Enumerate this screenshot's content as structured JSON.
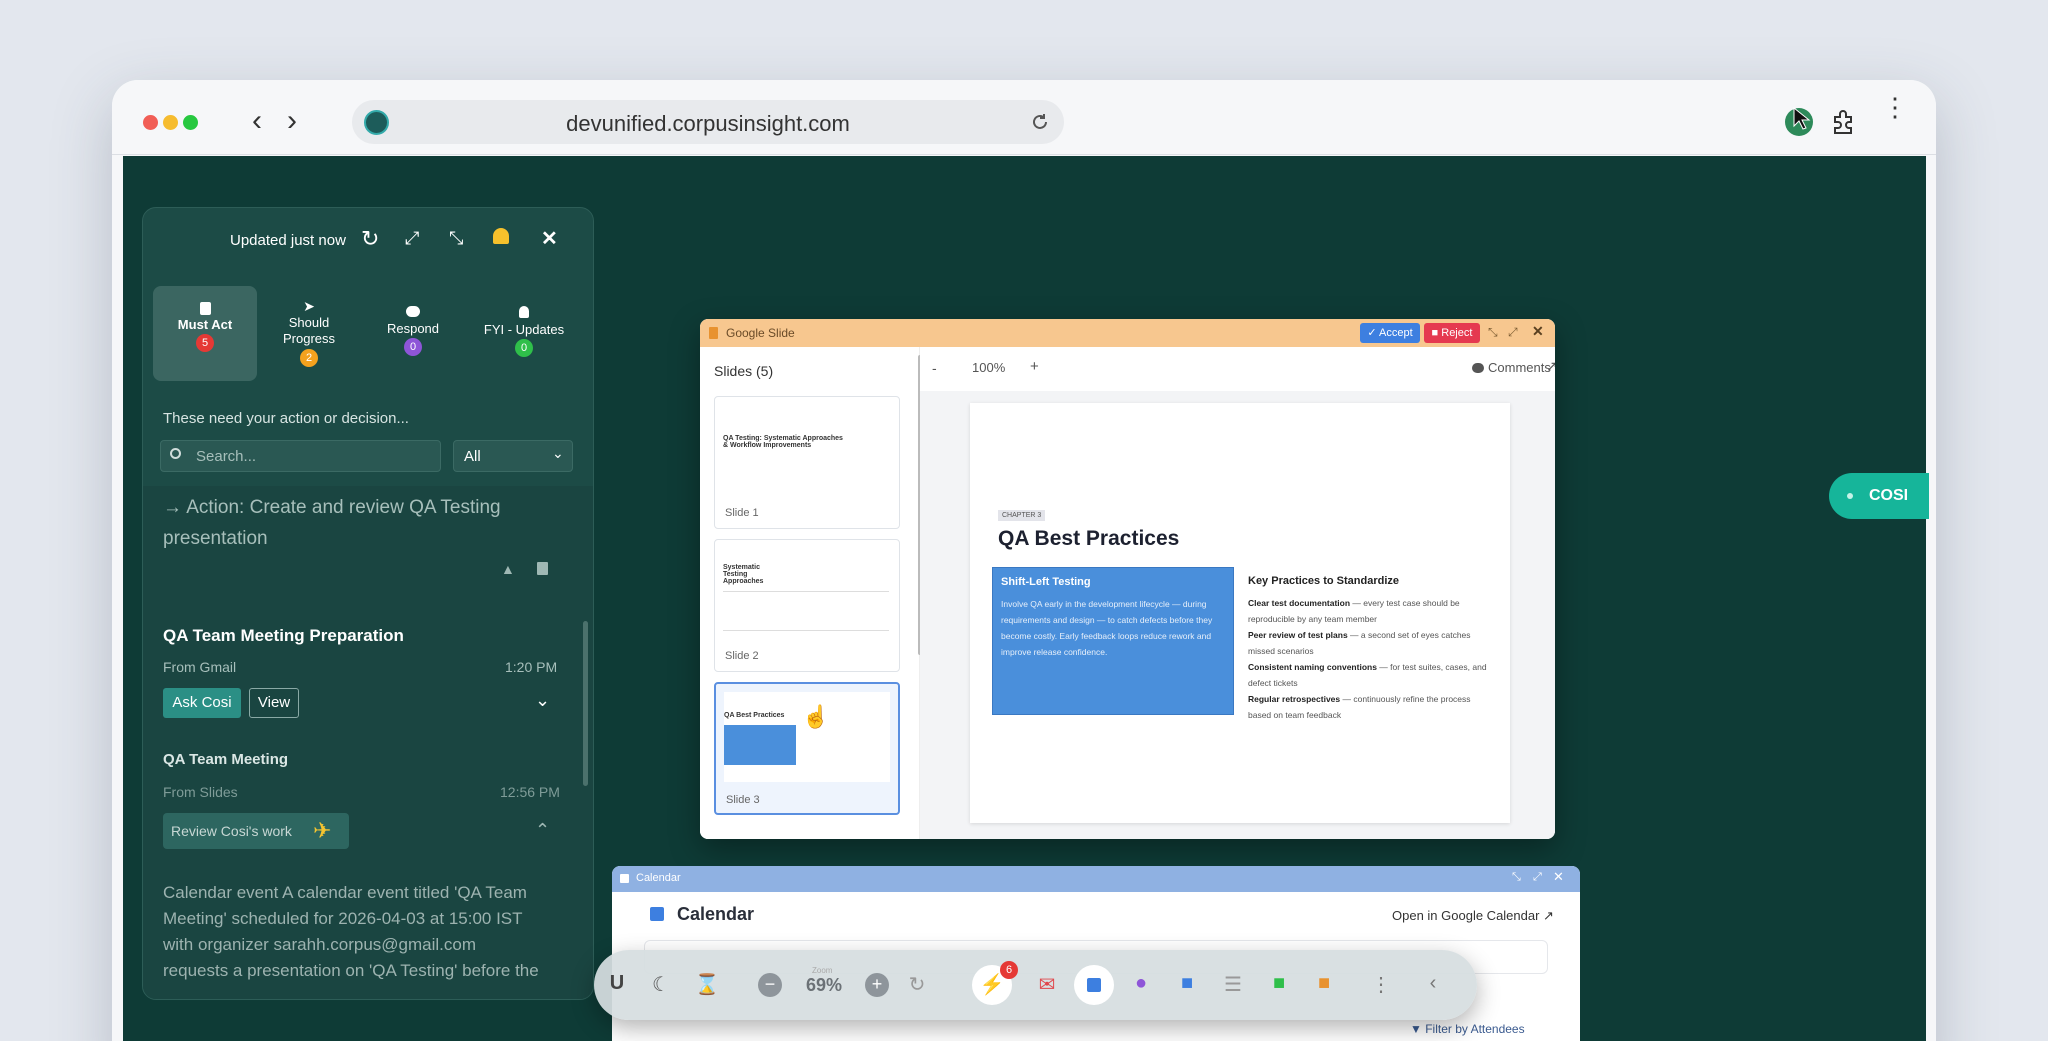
{
  "browser": {
    "url": "devunified.corpusinsight.com"
  },
  "panel": {
    "updated": "Updated just now",
    "tabs": [
      {
        "label": "Must Act",
        "count": "5",
        "icon": "clipboard-icon",
        "color": "#e53935"
      },
      {
        "label": "Should Progress",
        "count": "2",
        "icon": "paper-plane-icon",
        "color": "#f4a21e"
      },
      {
        "label": "Respond",
        "count": "0",
        "icon": "chat-icon",
        "color": "#8e55d8"
      },
      {
        "label": "FYI - Updates",
        "count": "0",
        "icon": "bulb-icon",
        "color": "#2fbf4a"
      }
    ],
    "hint": "These need your action or decision...",
    "search_placeholder": "Search...",
    "filter": "All",
    "action_text": "→ Action: Create and review QA Testing presentation",
    "item1": {
      "title": "QA Team Meeting Preparation",
      "source": "From Gmail",
      "time": "1:20 PM",
      "ask": "Ask Cosi",
      "view": "View"
    },
    "item2": {
      "title": "QA Team Meeting",
      "source": "From Slides",
      "time": "12:56 PM",
      "review": "Review Cosi's work"
    },
    "description": "Calendar event A calendar event titled 'QA Team Meeting' scheduled for 2026-04-03 at 15:00 IST with organizer sarahh.corpus@gmail.com requests a presentation on 'QA Testing' before the"
  },
  "slides_window": {
    "title": "Google Slide",
    "accept": "Accept",
    "reject": "Reject",
    "slides_header": "Slides (5)",
    "minus": "-",
    "zoom": "100%",
    "plus": "+",
    "comments": "Comments",
    "thumbs": [
      {
        "label": "Slide 1",
        "title": "QA Testing: Systematic Approaches & Workflow Improvements"
      },
      {
        "label": "Slide 2",
        "title": "Systematic Testing Approaches"
      },
      {
        "label": "Slide 3",
        "title": "QA Best Practices"
      }
    ],
    "slide": {
      "chapter": "CHAPTER 3",
      "title": "QA Best Practices",
      "box_title": "Shift-Left Testing",
      "box_text": "Involve QA early in the development lifecycle — during requirements and design — to catch defects before they become costly. Early feedback loops reduce rework and improve release confidence.",
      "right_title": "Key Practices to Standardize",
      "bullets": [
        {
          "bold": "Clear test documentation",
          "rest": " — every test case should be reproducible by any team member"
        },
        {
          "bold": "Peer review of test plans",
          "rest": " — a second set of eyes catches missed scenarios"
        },
        {
          "bold": "Consistent naming conventions",
          "rest": " — for test suites, cases, and defect tickets"
        },
        {
          "bold": "Regular retrospectives",
          "rest": " — continuously refine the process based on team feedback"
        }
      ]
    }
  },
  "calendar_window": {
    "title": "Calendar",
    "header": "Calendar",
    "open_link": "Open in Google Calendar",
    "filter": "Filter by Attendees"
  },
  "dock": {
    "zoom_label": "Zoom",
    "zoom": "69%",
    "u": "U",
    "notif_count": "6"
  },
  "cosi": "COSI"
}
